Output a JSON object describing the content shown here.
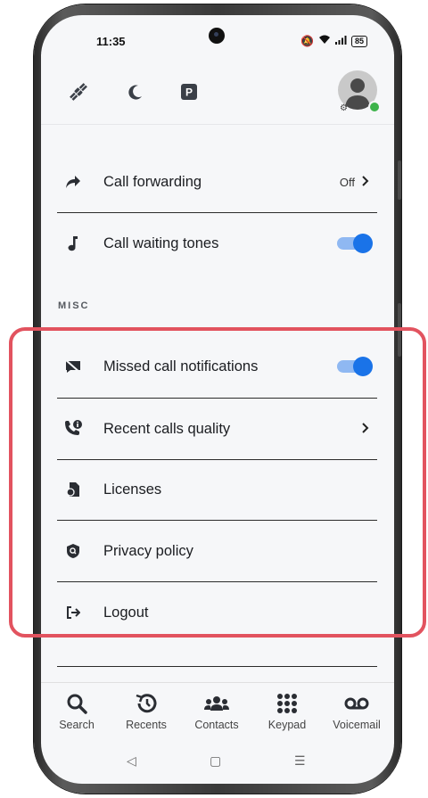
{
  "status_bar": {
    "time": "11:35",
    "battery": "85"
  },
  "topbar": {
    "icons": [
      "satellite-icon",
      "moon-icon",
      "parking-icon"
    ],
    "avatar": "avatar"
  },
  "settings": {
    "call_forwarding": {
      "label": "Call forwarding",
      "value": "Off"
    },
    "call_waiting": {
      "label": "Call waiting tones",
      "enabled": true
    },
    "section_misc": "MISC",
    "missed_calls": {
      "label": "Missed call notifications",
      "enabled": true
    },
    "recent_quality": {
      "label": "Recent calls quality"
    },
    "licenses": {
      "label": "Licenses"
    },
    "privacy": {
      "label": "Privacy policy"
    },
    "logout": {
      "label": "Logout"
    }
  },
  "bottom_nav": [
    {
      "label": "Search",
      "icon": "search-icon"
    },
    {
      "label": "Recents",
      "icon": "history-icon"
    },
    {
      "label": "Contacts",
      "icon": "contacts-icon"
    },
    {
      "label": "Keypad",
      "icon": "keypad-icon"
    },
    {
      "label": "Voicemail",
      "icon": "voicemail-icon"
    }
  ],
  "colors": {
    "accent": "#1a73e8",
    "highlight_border": "#e2535f",
    "presence": "#3db34a"
  }
}
